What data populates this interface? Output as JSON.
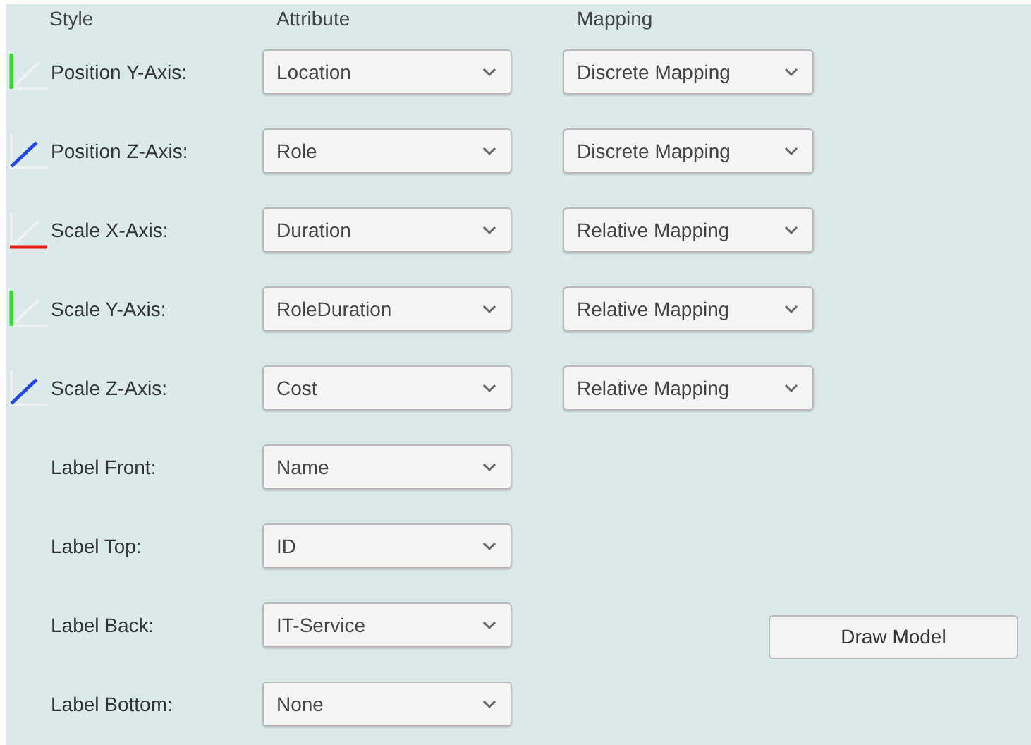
{
  "headers": [
    "Style",
    "Attribute",
    "Mapping"
  ],
  "rows": [
    {
      "label": "Position Y-Axis:",
      "kind": "y_axis",
      "attribute": "Location",
      "mapping": "Discrete Mapping"
    },
    {
      "label": "Position Z-Axis:",
      "kind": "z_axis",
      "attribute": "Role",
      "mapping": "Discrete Mapping"
    },
    {
      "label": "Scale X-Axis:",
      "kind": "x_axis",
      "attribute": "Duration",
      "mapping": "Relative Mapping"
    },
    {
      "label": "Scale Y-Axis:",
      "kind": "y_axis",
      "attribute": "RoleDuration",
      "mapping": "Relative Mapping"
    },
    {
      "label": "Scale Z-Axis:",
      "kind": "z_axis",
      "attribute": "Cost",
      "mapping": "Relative Mapping"
    },
    {
      "label": "Label Front:",
      "kind": "label",
      "attribute": "Name"
    },
    {
      "label": "Label Top:",
      "kind": "label",
      "attribute": "ID"
    },
    {
      "label": "Label Back:",
      "kind": "label",
      "attribute": "IT-Service"
    },
    {
      "label": "Label Bottom:",
      "kind": "label",
      "attribute": "None"
    }
  ],
  "draw_button": "Draw Model"
}
